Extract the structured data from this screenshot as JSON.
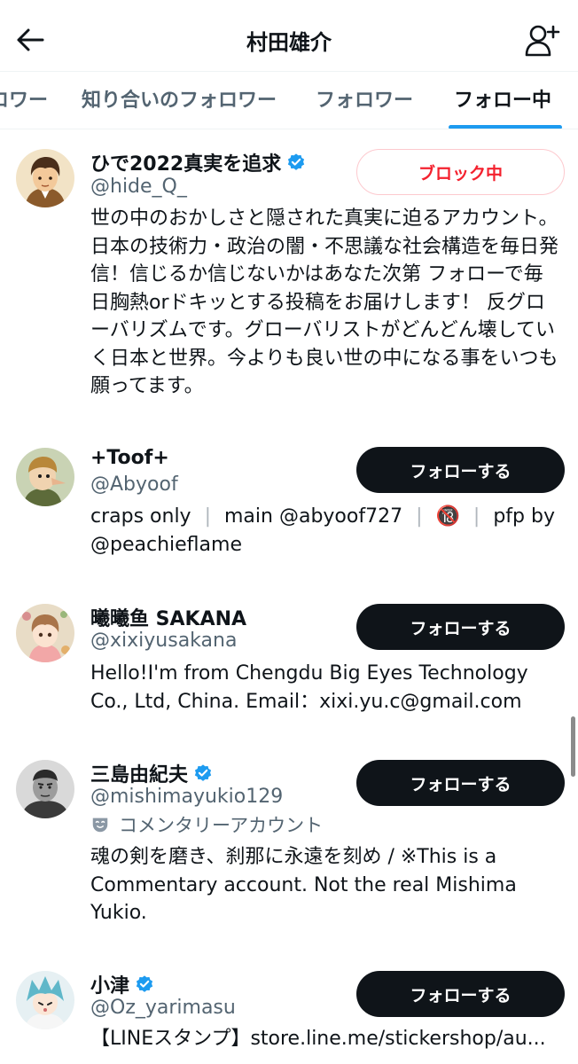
{
  "header": {
    "title": "村田雄介"
  },
  "tabs": [
    {
      "label": "ロワー"
    },
    {
      "label": "知り合いのフォロワー"
    },
    {
      "label": "フォロワー"
    },
    {
      "label": "フォロー中"
    }
  ],
  "active_tab": "フォロー中",
  "users": [
    {
      "name": "ひで2022真実を追求",
      "handle": "@hide_Q_",
      "verified": true,
      "button": "ブロック中",
      "bio": "世の中のおかしさと隠された真実に迫るアカウント。日本の技術力・政治の闇・不思議な社会構造を毎日発信！信じるか信じないかはあなた次第 フォローで毎日胸熱orドキッとする投稿をお届けします！ 反グローバリズムです。グローバリストがどんどん壊していく日本と世界。今よりも良い世の中になる事をいつも願ってます。"
    },
    {
      "name": "+Toof+",
      "handle": "@Abyoof",
      "verified": false,
      "button": "フォローする",
      "bio_parts": [
        "craps only",
        "main @abyoof727",
        "pfp by"
      ],
      "bio_line2": "@peachieflame",
      "bio_emoji": "🔞"
    },
    {
      "name": "曦曦鱼 SAKANA",
      "handle": "@xixiyusakana",
      "verified": false,
      "button": "フォローする",
      "bio": "Hello!I'm from Chengdu Big Eyes Technology Co., Ltd, China. Email：xixi.yu.c@gmail.com"
    },
    {
      "name": "三島由紀夫",
      "handle": "@mishimayukio129",
      "verified": true,
      "commentary_label": "コメンタリーアカウント",
      "button": "フォローする",
      "bio": "魂の剣を磨き、刹那に永遠を刻め / ※This is a Commentary account. Not the real Mishima Yukio."
    },
    {
      "name": "小津",
      "handle": "@Oz_yarimasu",
      "verified": true,
      "button": "フォローする",
      "bio": "【LINEスタンプ】store.line.me/stickershop/au..."
    }
  ],
  "colors": {
    "accent": "#1d9bf0",
    "follow_button": "#0f1419",
    "blocked_text": "#f4212e",
    "secondary_text": "#536471"
  },
  "icons": {
    "back": "arrow-left-icon",
    "add_user": "add-user-icon",
    "verified": "verified-badge-icon",
    "commentary": "mask-icon"
  }
}
